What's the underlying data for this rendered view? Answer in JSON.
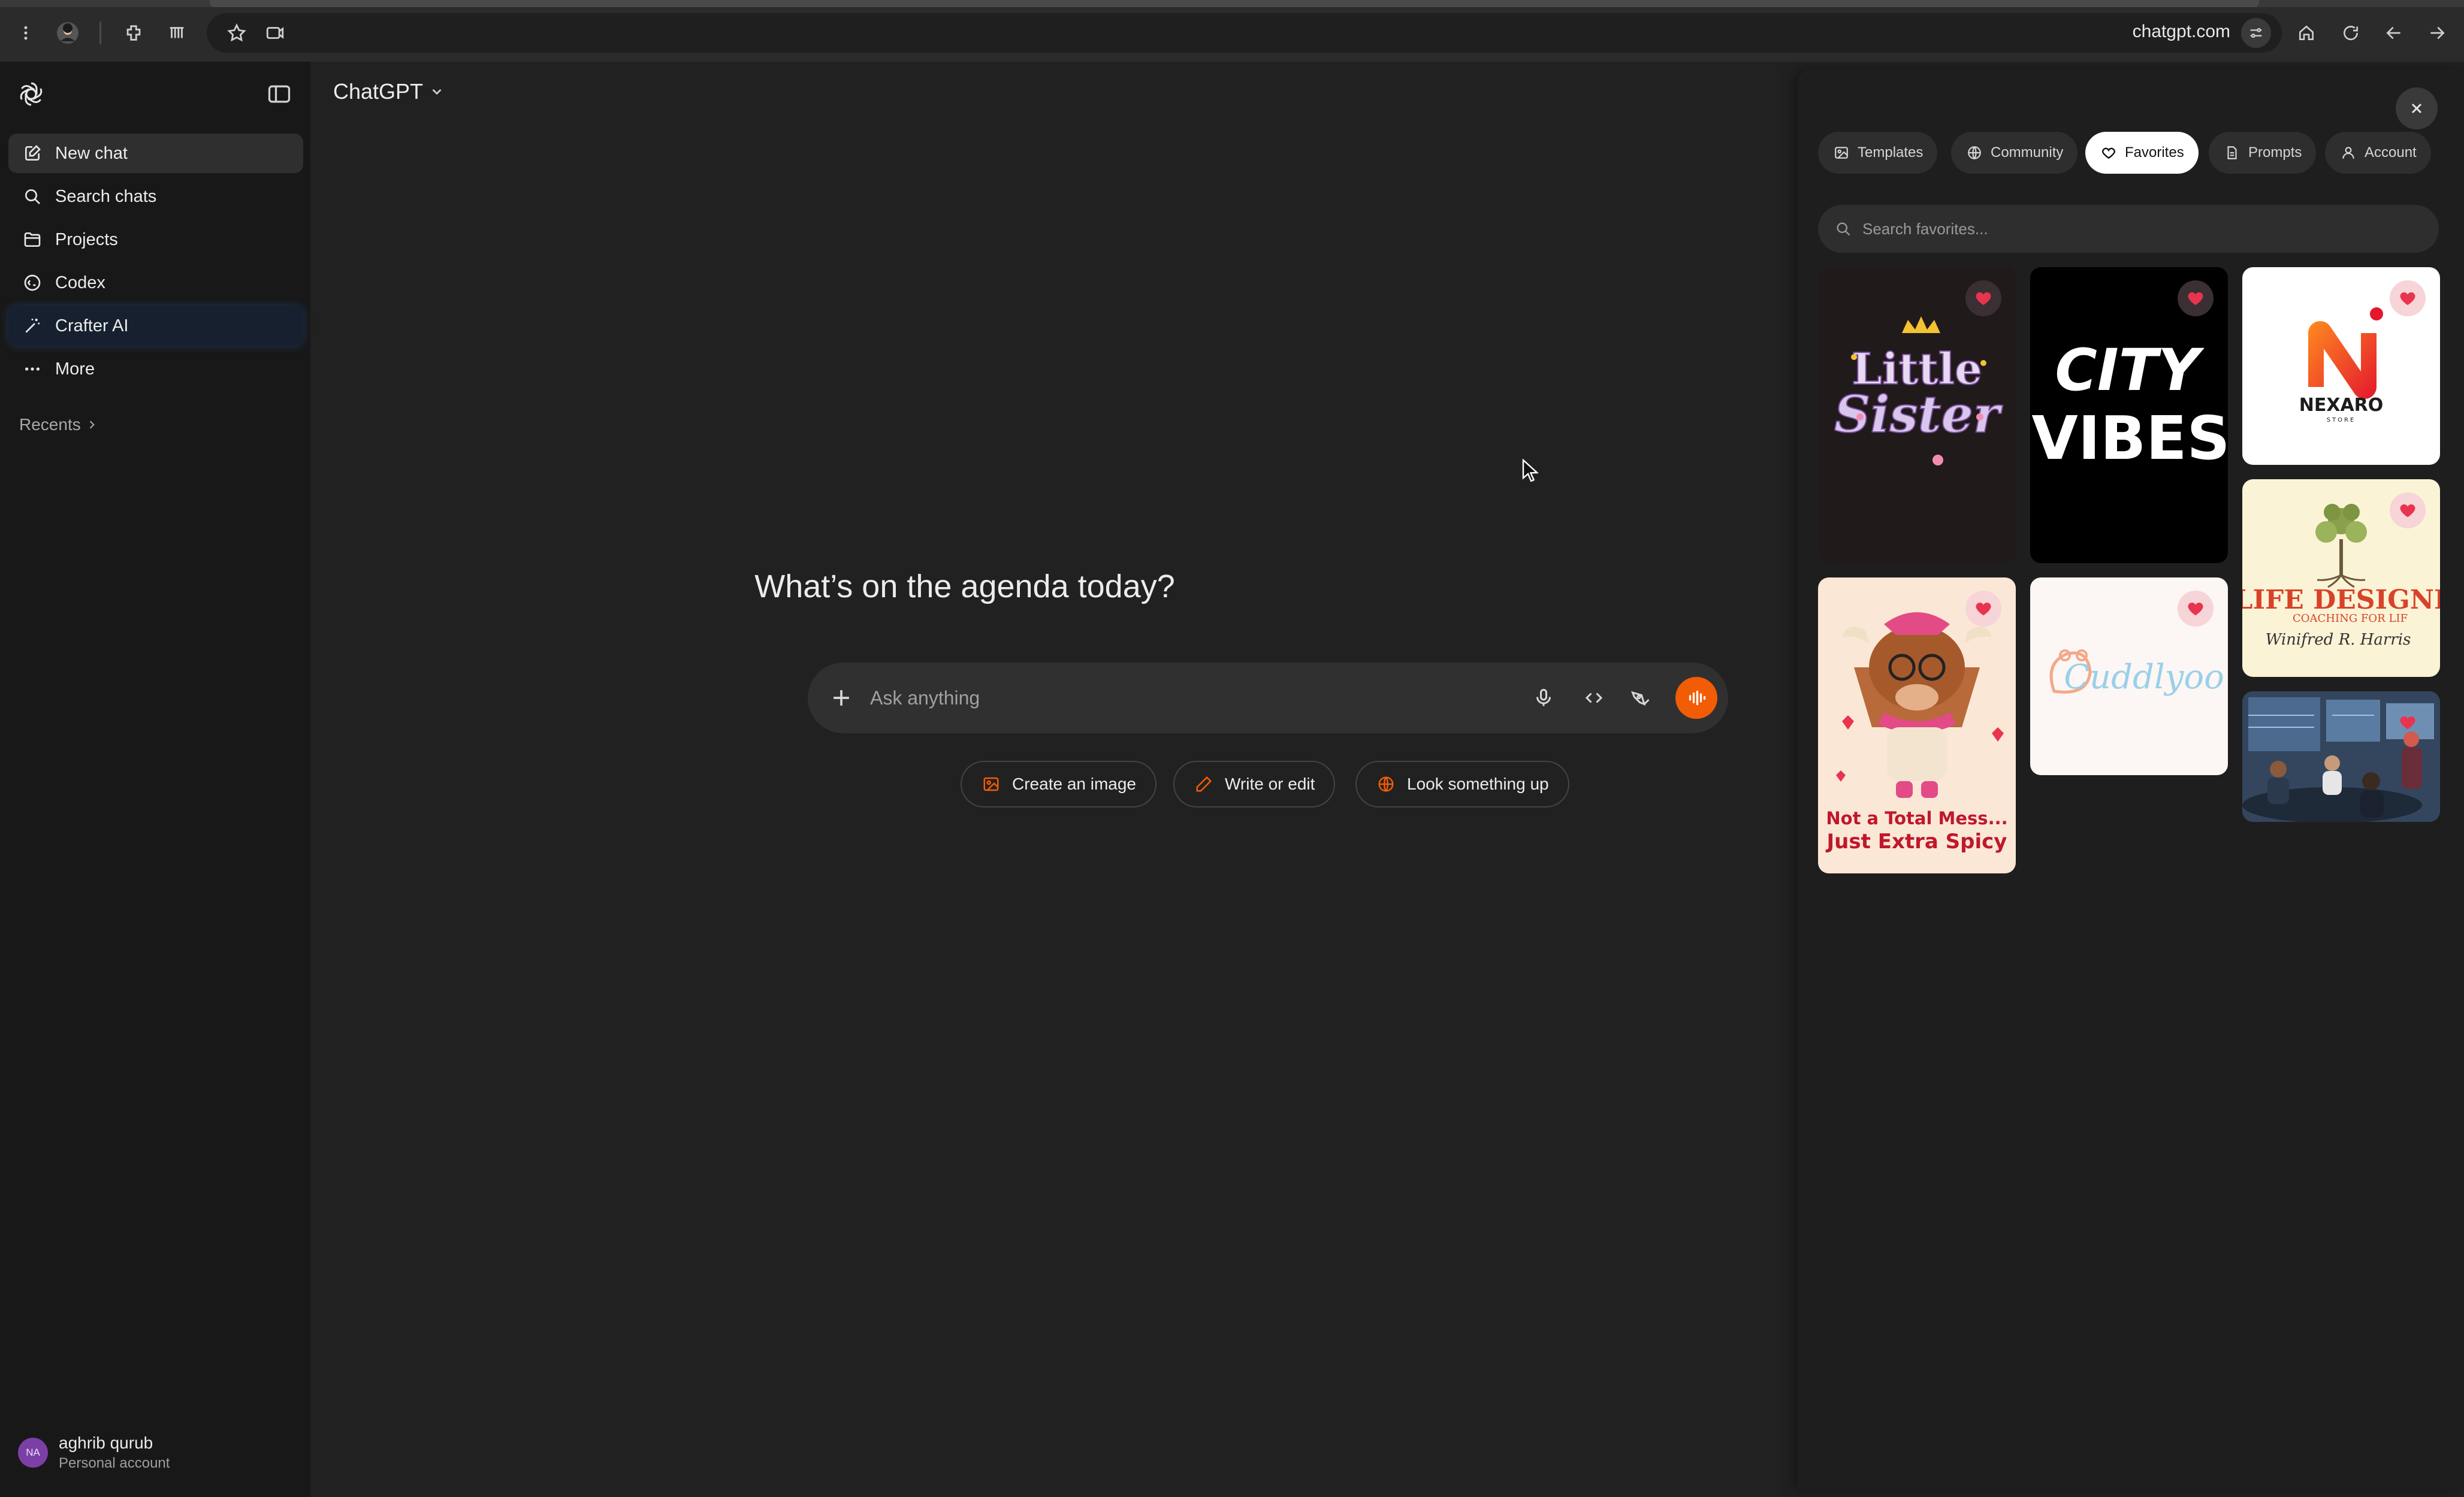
{
  "browser": {
    "url": "chatgpt.com"
  },
  "sidebar": {
    "items": [
      {
        "label": "New chat",
        "icon": "edit-icon"
      },
      {
        "label": "Search chats",
        "icon": "search-icon"
      },
      {
        "label": "Projects",
        "icon": "folder-icon"
      },
      {
        "label": "Codex",
        "icon": "codex-icon"
      },
      {
        "label": "Crafter AI",
        "icon": "magic-wand-icon"
      },
      {
        "label": "More",
        "icon": "more-dots-icon"
      }
    ],
    "recents_label": "Recents",
    "user": {
      "initials": "NA",
      "name": "aghrib qurub",
      "subtitle": "Personal account"
    }
  },
  "main": {
    "model": "ChatGPT",
    "headline": "What’s on the agenda today?",
    "composer": {
      "placeholder": "Ask anything"
    },
    "chips": [
      {
        "label": "Create an image",
        "icon": "image-icon"
      },
      {
        "label": "Write or edit",
        "icon": "pencil-icon"
      },
      {
        "label": "Look something up",
        "icon": "globe-icon"
      }
    ]
  },
  "panel": {
    "tabs": [
      {
        "label": "Templates",
        "icon": "image-icon"
      },
      {
        "label": "Community",
        "icon": "globe-icon"
      },
      {
        "label": "Favorites",
        "icon": "heart-icon",
        "active": true
      },
      {
        "label": "Prompts",
        "icon": "document-icon"
      },
      {
        "label": "Account",
        "icon": "user-icon"
      }
    ],
    "search_placeholder": "Search favorites...",
    "favorites": [
      {
        "title_line1": "Little",
        "title_line2": "Sister"
      },
      {
        "title_line1": "CITY",
        "title_line2": "VIBES"
      },
      {
        "brand": "NEXARO",
        "tagline": "STORE"
      },
      {
        "title": "LIFE DESIGNE",
        "tagline": "COACHING FOR LIF",
        "signature": "Winifred R. Harris"
      },
      {
        "caption_line1": "Not a Total Mess...",
        "caption_line2": "Just Extra Spicy"
      },
      {
        "brand": "Cuddlyoo"
      },
      {
        "kind": "team meeting photo"
      }
    ]
  },
  "colors": {
    "accent": "#f25c05",
    "heart": "#e8344e",
    "background": "#212121",
    "sidebar": "#181818"
  }
}
